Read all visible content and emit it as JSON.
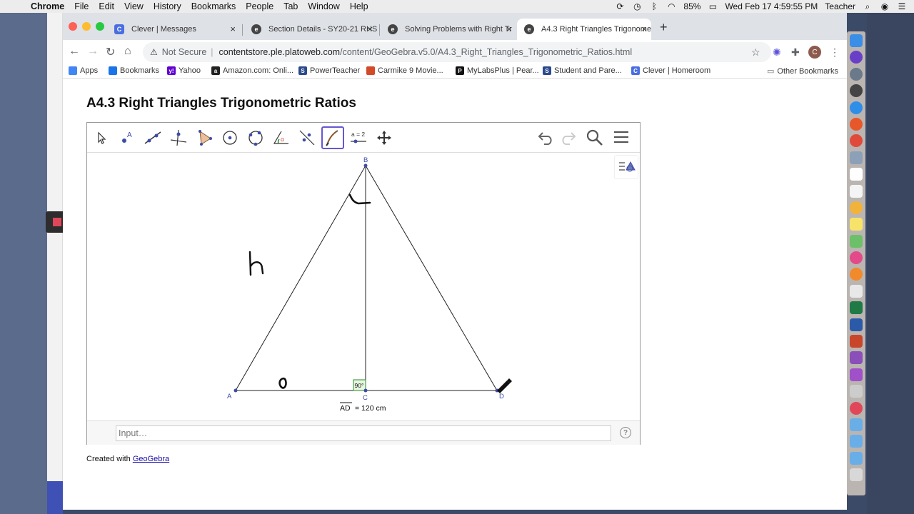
{
  "menubar": {
    "app": "Chrome",
    "items": [
      "File",
      "Edit",
      "View",
      "History",
      "Bookmarks",
      "People",
      "Tab",
      "Window",
      "Help"
    ],
    "battery": "85%",
    "datetime": "Wed Feb 17  4:59:55 PM",
    "user": "Teacher"
  },
  "tabs": [
    {
      "title": "Clever | Messages",
      "favicon": "C",
      "color": "#4a6ee0"
    },
    {
      "title": "Section Details - SY20-21 RHS",
      "favicon": "e",
      "color": "#444"
    },
    {
      "title": "Solving Problems with Right Tr",
      "favicon": "e",
      "color": "#444"
    },
    {
      "title": "A4.3 Right Triangles Trigonome",
      "favicon": "e",
      "color": "#444"
    }
  ],
  "address": {
    "security": "Not Secure",
    "domain": "contentstore.ple.platoweb.com",
    "path": "/content/GeoGebra.v5.0/A4.3_Right_Triangles_Trigonometric_Ratios.html"
  },
  "bookmarks": [
    {
      "label": "Apps",
      "icon": "apps-grid-icon",
      "color": "#4285f4"
    },
    {
      "label": "Bookmarks",
      "icon": "star-icon",
      "color": "#1a73e8"
    },
    {
      "label": "Yahoo",
      "icon": "yahoo-icon",
      "color": "#6001d2"
    },
    {
      "label": "Amazon.com: Onli...",
      "icon": "amazon-icon",
      "color": "#222"
    },
    {
      "label": "PowerTeacher",
      "icon": "sis-icon",
      "color": "#2b4a8c"
    },
    {
      "label": "Carmike 9 Movie...",
      "icon": "carmike-icon",
      "color": "#d24a2a"
    },
    {
      "label": "MyLabsPlus | Pear...",
      "icon": "pearson-icon",
      "color": "#111"
    },
    {
      "label": "Student and Pare...",
      "icon": "sis-icon",
      "color": "#2b4a8c"
    },
    {
      "label": "Clever | Homeroom",
      "icon": "clever-icon",
      "color": "#4a6ee0"
    }
  ],
  "other_bookmarks": "Other Bookmarks",
  "page": {
    "title": "A4.3 Right Triangles Trigonometric Ratios",
    "created_prefix": "Created with ",
    "created_link": "GeoGebra"
  },
  "geogebra": {
    "input_placeholder": "Input…",
    "help": "?",
    "tools": [
      "move-tool",
      "point-tool",
      "line-tool",
      "perpendicular-line-tool",
      "polygon-tool",
      "circle-tool",
      "circle-three-points-tool",
      "angle-tool",
      "reflect-tool",
      "pen-tool",
      "slider-tool",
      "move-graphics-tool"
    ],
    "slider_icon_text": "a = 2",
    "points": {
      "A": "A",
      "B": "B",
      "C": "C",
      "D": "D"
    },
    "angle_label": "90°",
    "measure_label": "AD",
    "measure_value": "= 120 cm"
  }
}
